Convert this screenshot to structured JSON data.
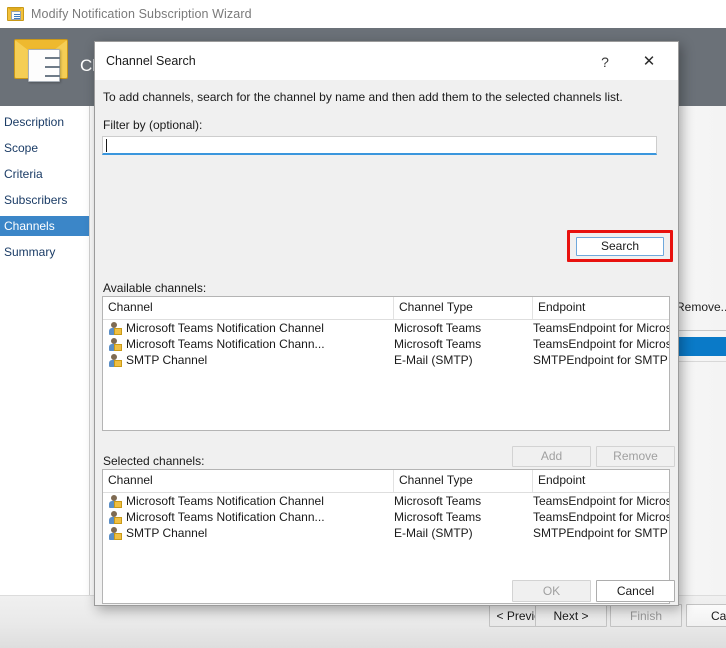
{
  "window": {
    "title": "Modify Notification Subscription Wizard",
    "icon": "envelope-checklist-icon",
    "header_title": "Cha"
  },
  "sidebar": {
    "items": [
      {
        "label": "Description",
        "selected": false
      },
      {
        "label": "Scope",
        "selected": false
      },
      {
        "label": "Criteria",
        "selected": false
      },
      {
        "label": "Subscribers",
        "selected": false
      },
      {
        "label": "Channels",
        "selected": true
      },
      {
        "label": "Summary",
        "selected": false
      }
    ]
  },
  "background": {
    "remove_button_label": "Remove...",
    "selected_row_color": "#0a7ac8"
  },
  "wizard_footer": {
    "previous_label": "< Previous",
    "next_label": "Next >",
    "finish_label": "Finish",
    "cancel_label": "Can"
  },
  "dialog": {
    "title": "Channel Search",
    "help_glyph": "?",
    "close_glyph": "✕",
    "instruction": "To add channels, search for the channel by name and then add them to the selected channels list.",
    "filter": {
      "label": "Filter by (optional):",
      "value": "",
      "placeholder": ""
    },
    "search_button_label": "Search",
    "search_highlight_color": "#e8120f",
    "available": {
      "label": "Available channels:",
      "columns": [
        "Channel",
        "Channel Type",
        "Endpoint"
      ],
      "rows": [
        [
          "Microsoft Teams Notification Channel",
          "Microsoft Teams",
          "TeamsEndpoint for Microsoft Te..."
        ],
        [
          "Microsoft Teams Notification Chann...",
          "Microsoft Teams",
          "TeamsEndpoint for Microsoft Te..."
        ],
        [
          "SMTP Channel",
          "E-Mail (SMTP)",
          "SMTPEndpoint for SMTP Channel"
        ]
      ]
    },
    "selected": {
      "label": "Selected channels:",
      "columns": [
        "Channel",
        "Channel Type",
        "Endpoint"
      ],
      "rows": [
        [
          "Microsoft Teams Notification Channel",
          "Microsoft Teams",
          "TeamsEndpoint for Microsoft Te..."
        ],
        [
          "Microsoft Teams Notification Chann...",
          "Microsoft Teams",
          "TeamsEndpoint for Microsoft Te..."
        ],
        [
          "SMTP Channel",
          "E-Mail (SMTP)",
          "SMTPEndpoint for SMTP Channel"
        ]
      ]
    },
    "add_button_label": "Add",
    "remove_button_label": "Remove",
    "ok_button_label": "OK",
    "cancel_button_label": "Cancel"
  }
}
